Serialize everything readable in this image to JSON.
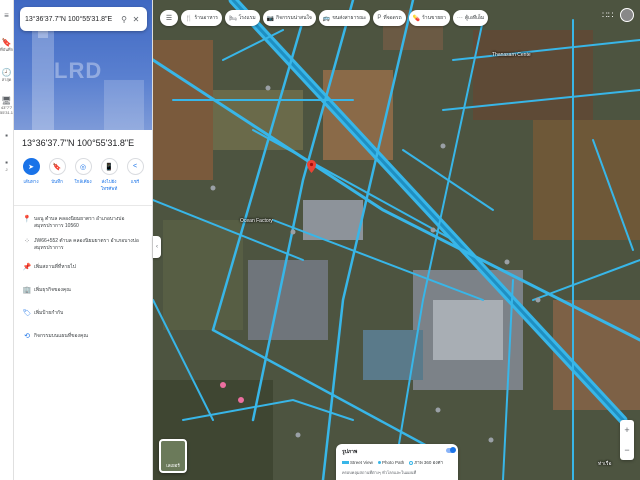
{
  "rail": {
    "items": [
      {
        "icon": "≡",
        "label": ""
      },
      {
        "icon": "🔖",
        "label": "ที่บันทึก"
      },
      {
        "icon": "🕘",
        "label": "ล่าสุด"
      },
      {
        "icon": "🖥",
        "label": "43°7'7 55'31.1"
      },
      {
        "icon": "▪",
        "label": ""
      },
      {
        "icon": "▪",
        "label": "J"
      }
    ]
  },
  "panel": {
    "search_value": "13°36'37.7\"N 100°55'31.8\"E",
    "hero_watermark": "LRD",
    "title": "13°36'37.7\"N 100°55'31.8\"E",
    "actions": [
      {
        "icon": "➤",
        "label": "เส้นทาง",
        "primary": true
      },
      {
        "icon": "🔖",
        "label": "บันทึก",
        "primary": false
      },
      {
        "icon": "◎",
        "label": "ใกล้เคียง",
        "primary": false
      },
      {
        "icon": "📱",
        "label": "ส่งไปยังโทรศัพท์",
        "primary": false
      },
      {
        "icon": "<",
        "label": "แชร์",
        "primary": false
      }
    ],
    "info_rows": [
      {
        "icon": "📍",
        "text": "บอนู ตำบล คลองนิยมยาตรา อำเภอบางบ่อ สมุทรปราการ 10560"
      },
      {
        "icon": "⁘",
        "text": "JW66+552 ตำบล คลองนิยมยาตรา อำเภอบางบ่อ สมุทรปราการ"
      },
      {
        "icon": "📌",
        "text": "เพิ่มสถานที่ที่หายไป"
      },
      {
        "icon": "🏢",
        "text": "เพิ่มธุรกิจของคุณ"
      },
      {
        "icon": "🏷",
        "text": "เพิ่มป้ายกำกับ"
      },
      {
        "icon": "⟲",
        "text": "กิจกรรมบนแผนที่ของคุณ"
      }
    ]
  },
  "map": {
    "chips": [
      {
        "icon": "🍴",
        "label": "ร้านอาหาร"
      },
      {
        "icon": "🛏",
        "label": "โรงแรม"
      },
      {
        "icon": "📷",
        "label": "กิจกรรมน่าสนใจ"
      },
      {
        "icon": "🚌",
        "label": "ขนส่งสาธารณะ"
      },
      {
        "icon": "P",
        "label": "ที่จอดรถ"
      },
      {
        "icon": "💊",
        "label": "ร้านขายยา"
      },
      {
        "icon": "···",
        "label": "ตู้เอทีเอ็ม"
      }
    ],
    "labels": [
      {
        "text": "Thanasarn Cente",
        "id": "thanasarn"
      },
      {
        "text": "Ocean Factory",
        "id": "ocean"
      },
      {
        "text": "ท่าเรือ",
        "id": "pier"
      }
    ],
    "layer_label": "เลเยอร์",
    "streetview_card": {
      "heading": "รูปภาพ",
      "legend": [
        {
          "kind": "line",
          "label": "Street View"
        },
        {
          "kind": "dot",
          "label": "Photo Path"
        },
        {
          "kind": "ring",
          "label": "ภาพ 360 องศา"
        }
      ],
      "footer": "ครอบคลุมสถานที่ต่างๆ ทั่วโลกและในแผนที่"
    },
    "zoom_in": "+",
    "zoom_out": "−",
    "colors": {
      "street_view_line": "#38b6e8",
      "pin": "#ea4335",
      "accent": "#1a73e8"
    }
  }
}
